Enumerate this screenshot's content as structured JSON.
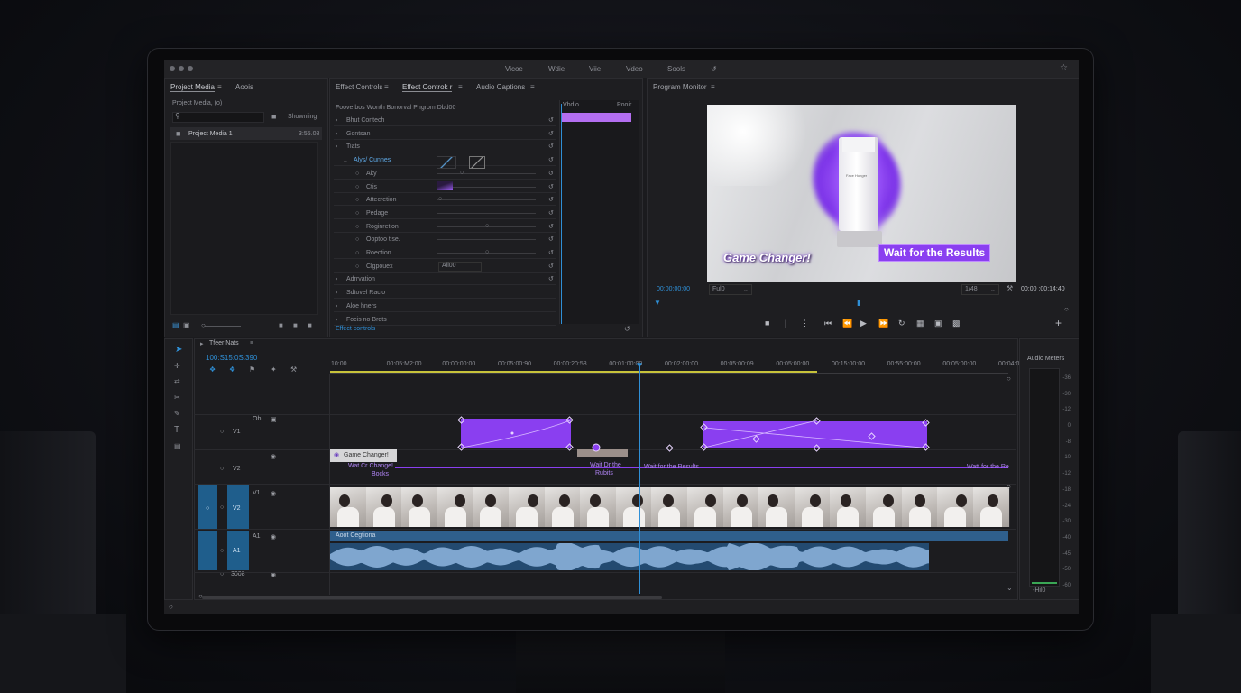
{
  "menubar": {
    "items": [
      "Vicoe",
      "Wdie",
      "Viie",
      "Vdeo",
      "Sools"
    ],
    "share_icon": "share-icon",
    "star_icon": "star-icon"
  },
  "project_panel": {
    "tabs": [
      "Project Media",
      "Aoois"
    ],
    "title": "Project Media, (o)",
    "search_placeholder": "",
    "view_label": "Showniing",
    "bin_name": "Project Media 1",
    "bin_duration": "3:55.08"
  },
  "effect_controls": {
    "tabs": [
      "Effect Controls",
      "Effect Controk r",
      "Audio Captions"
    ],
    "header": "Foove bos Wonth Bonorval Pngrom Dbd00",
    "mini_timeline": {
      "left": "Vbdio",
      "right": "Pooir"
    },
    "rows": [
      {
        "label": "Bhut Contech"
      },
      {
        "label": "Gontsan"
      },
      {
        "label": "Tiats"
      },
      {
        "label": "Alys/ Cunnes"
      },
      {
        "label": "Aky"
      },
      {
        "label": "Ctis"
      },
      {
        "label": "Attecretion"
      },
      {
        "label": "Pedage"
      },
      {
        "label": "Roginretion"
      },
      {
        "label": "Ooptoo tise."
      },
      {
        "label": "Roection"
      },
      {
        "label": "Clgpouex",
        "value": "Ali00"
      },
      {
        "label": "Adrrvation"
      },
      {
        "label": "Sdtovel Racio"
      },
      {
        "label": "Aloe hners"
      },
      {
        "label": "Focis no Brdts"
      }
    ],
    "footer": "Effect controls"
  },
  "program_monitor": {
    "title": "Program Monitor",
    "overlay_left": "Game Changer!",
    "overlay_right": "Wait for the Results",
    "bottle_label": "Face Honger",
    "timecode_left": "00:00:00:00",
    "fit_value": "Ful0",
    "quality_value": "1/48",
    "timecode_right": "00:00 :00:14:40"
  },
  "timeline": {
    "title": "Tfeer Nats",
    "timecode": "100:S15:0S:390",
    "ruler": [
      "10:00",
      "00:05:M2:00",
      "00:00:00:00",
      "00:05:00:90",
      "00:00:20:58",
      "00:01:00:00",
      "00:02:00:00",
      "00:05:00:09",
      "00:05:00:00",
      "00:15:00:00",
      "00:55:00:00",
      "00:05:00:00",
      "00:04:00:00"
    ],
    "tracks": [
      {
        "left": "Ob",
        "name": "V1"
      },
      {
        "left": "",
        "name": "V2"
      },
      {
        "left": "V1",
        "name": "V2"
      },
      {
        "left": "A1",
        "name": "A1"
      },
      {
        "left": "",
        "name": "3008"
      }
    ],
    "caption_clip": "Game Changer!",
    "caption_texts": [
      "Wat Cr Change!",
      "Bocks",
      "Wait Dr the",
      "Rubits",
      "Wait for the Results",
      "Watt for the Re"
    ],
    "audio_clip_label": "Aoot Cegtiona"
  },
  "audio_meters": {
    "title": "Audio Meters",
    "scale": [
      "-36",
      "-30",
      "-12",
      "0",
      "-8",
      "-10",
      "-12",
      "-18",
      "-24",
      "-30",
      "-40",
      "-45",
      "-50",
      "-60"
    ],
    "bottom": "-Hil0"
  },
  "colors": {
    "accent": "#8a3ff0",
    "playhead": "#2f8fd6",
    "audio": "#3d6f9e"
  }
}
